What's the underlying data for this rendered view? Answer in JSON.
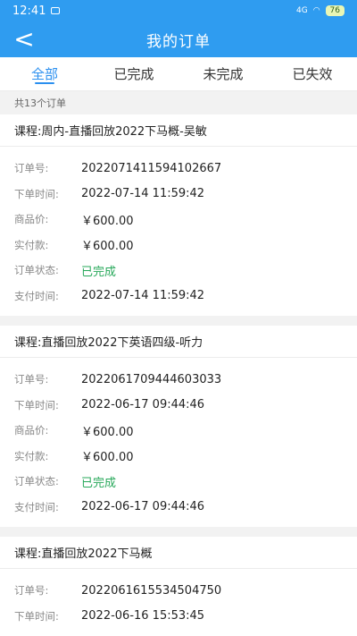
{
  "status_bar": {
    "time": "12:41",
    "network": "4G",
    "battery": "76"
  },
  "navbar": {
    "back": "<",
    "title": "我的订单"
  },
  "tabs": [
    "全部",
    "已完成",
    "未完成",
    "已失效"
  ],
  "summary": "共13个订单",
  "orders": [
    {
      "course_label": "课程:",
      "course_name": "周内-直播回放2022下马概-吴敏",
      "rows": [
        {
          "label": "订单号:",
          "value": "2022071411594102667"
        },
        {
          "label": "下单时间:",
          "value": "2022-07-14 11:59:42"
        },
        {
          "label": "商品价:",
          "value": "￥600.00"
        },
        {
          "label": "实付款:",
          "value": "￥600.00"
        },
        {
          "label": "订单状态:",
          "value": "已完成"
        },
        {
          "label": "支付时间:",
          "value": "2022-07-14 11:59:42"
        }
      ]
    },
    {
      "course_label": "课程:",
      "course_name": "直播回放2022下英语四级-听力",
      "rows": [
        {
          "label": "订单号:",
          "value": "2022061709444603033"
        },
        {
          "label": "下单时间:",
          "value": "2022-06-17 09:44:46"
        },
        {
          "label": "商品价:",
          "value": "￥600.00"
        },
        {
          "label": "实付款:",
          "value": "￥600.00"
        },
        {
          "label": "订单状态:",
          "value": "已完成"
        },
        {
          "label": "支付时间:",
          "value": "2022-06-17 09:44:46"
        }
      ]
    },
    {
      "course_label": "课程:",
      "course_name": "直播回放2022下马概",
      "rows": [
        {
          "label": "订单号:",
          "value": "2022061615534504750"
        },
        {
          "label": "下单时间:",
          "value": "2022-06-16 15:53:45"
        }
      ]
    }
  ],
  "colors": {
    "primary": "#2f9cf0",
    "active_tab": "#2a8fef",
    "status_done": "#27a85a"
  }
}
